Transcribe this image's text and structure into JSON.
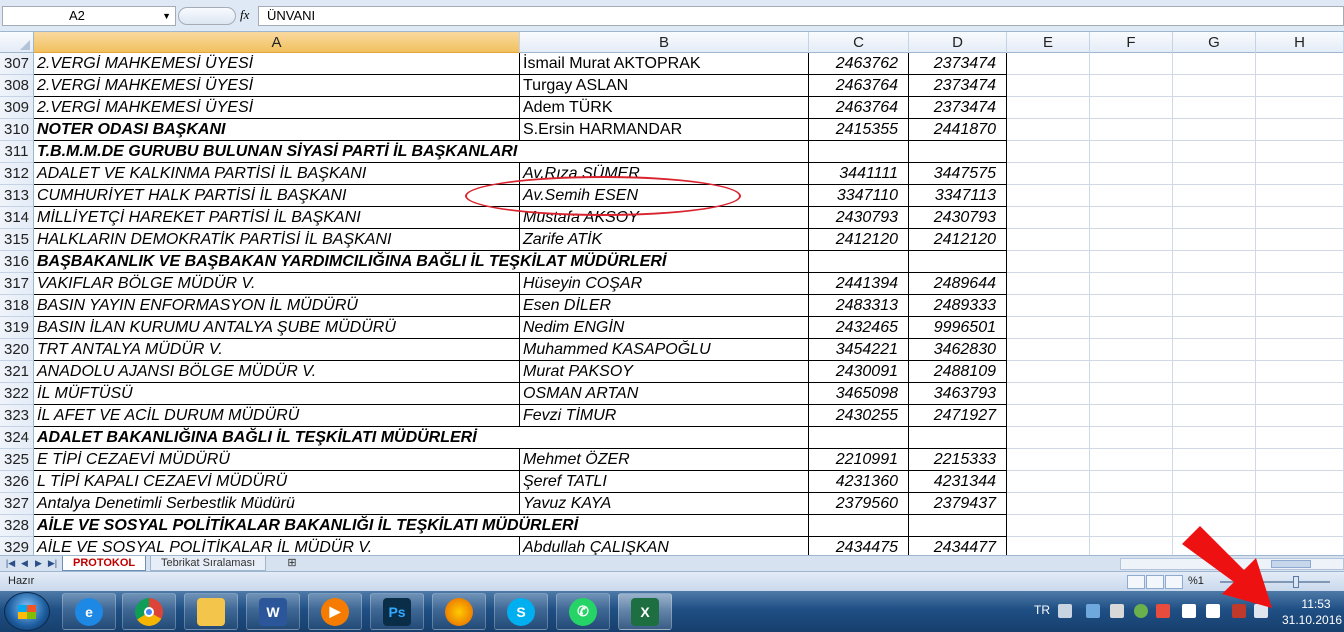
{
  "formula_bar": {
    "cell_ref": "A2",
    "fx_label": "fx",
    "content": "ÜNVANI"
  },
  "columns": [
    "A",
    "B",
    "C",
    "D",
    "E",
    "F",
    "G",
    "H"
  ],
  "rows": [
    {
      "num": "307",
      "a": "2.VERGİ MAHKEMESİ ÜYESİ",
      "b": "İsmail Murat AKTOPRAK",
      "c": "2463762",
      "d": "2373474",
      "style": "normal"
    },
    {
      "num": "308",
      "a": "2.VERGİ MAHKEMESİ ÜYESİ",
      "b": "Turgay ASLAN",
      "c": "2463764",
      "d": "2373474",
      "style": "normal"
    },
    {
      "num": "309",
      "a": "2.VERGİ MAHKEMESİ ÜYESİ",
      "b": "Adem TÜRK",
      "c": "2463764",
      "d": "2373474",
      "style": "normal"
    },
    {
      "num": "310",
      "a": "NOTER ODASI BAŞKANI",
      "b": "S.Ersin HARMANDAR",
      "c": "2415355",
      "d": "2441870",
      "style": "bold"
    },
    {
      "num": "311",
      "a": "T.B.M.M.DE GURUBU BULUNAN SİYASİ PARTİ İL BAŞKANLARI",
      "b": "",
      "c": "",
      "d": "",
      "style": "header"
    },
    {
      "num": "312",
      "a": "ADALET VE KALKINMA PARTİSİ İL BAŞKANI",
      "b": "Av.Rıza SÜMER",
      "c": "3441111",
      "d": "3447575",
      "style": "italicb"
    },
    {
      "num": "313",
      "a": "CUMHURİYET HALK PARTİSİ İL BAŞKANI",
      "b": "Av.Semih ESEN",
      "c": "3347110",
      "d": "3347113",
      "style": "italicb"
    },
    {
      "num": "314",
      "a": "MİLLİYETÇİ HAREKET PARTİSİ İL BAŞKANI",
      "b": "Mustafa AKSOY",
      "c": "2430793",
      "d": "2430793",
      "style": "italicb"
    },
    {
      "num": "315",
      "a": "HALKLARIN DEMOKRATİK PARTİSİ İL BAŞKANI",
      "b": "Zarife ATİK",
      "c": "2412120",
      "d": "2412120",
      "style": "italicb"
    },
    {
      "num": "316",
      "a": "BAŞBAKANLIK VE BAŞBAKAN YARDIMCILIĞINA BAĞLI İL TEŞKİLAT MÜDÜRLERİ",
      "b": "",
      "c": "",
      "d": "",
      "style": "header"
    },
    {
      "num": "317",
      "a": "VAKIFLAR BÖLGE MÜDÜR V.",
      "b": "Hüseyin COŞAR",
      "c": "2441394",
      "d": "2489644",
      "style": "italicb"
    },
    {
      "num": "318",
      "a": "BASIN YAYIN ENFORMASYON İL MÜDÜRÜ",
      "b": "Esen DİLER",
      "c": "2483313",
      "d": "2489333",
      "style": "italicb"
    },
    {
      "num": "319",
      "a": "BASIN İLAN KURUMU ANTALYA ŞUBE MÜDÜRÜ",
      "b": "Nedim ENGİN",
      "c": "2432465",
      "d": "9996501",
      "style": "italicb"
    },
    {
      "num": "320",
      "a": "TRT ANTALYA MÜDÜR V.",
      "b": "Muhammed KASAPOĞLU",
      "c": "3454221",
      "d": "3462830",
      "style": "italicb"
    },
    {
      "num": "321",
      "a": "ANADOLU AJANSI BÖLGE MÜDÜR V.",
      "b": "Murat PAKSOY",
      "c": "2430091",
      "d": "2488109",
      "style": "italicb"
    },
    {
      "num": "322",
      "a": "İL MÜFTÜSÜ",
      "b": "OSMAN ARTAN",
      "c": "3465098",
      "d": "3463793",
      "style": "italicb"
    },
    {
      "num": "323",
      "a": "İL AFET VE ACİL DURUM MÜDÜRÜ",
      "b": "Fevzi TİMUR",
      "c": "2430255",
      "d": "2471927",
      "style": "italicb"
    },
    {
      "num": "324",
      "a": "ADALET BAKANLIĞINA BAĞLI İL TEŞKİLATI MÜDÜRLERİ",
      "b": "",
      "c": "",
      "d": "",
      "style": "header"
    },
    {
      "num": "325",
      "a": "E TİPİ CEZAEVİ MÜDÜRÜ",
      "b": "Mehmet ÖZER",
      "c": "2210991",
      "d": "2215333",
      "style": "italicb"
    },
    {
      "num": "326",
      "a": "L TİPİ KAPALI CEZAEVİ MÜDÜRÜ",
      "b": "Şeref TATLI",
      "c": "4231360",
      "d": "4231344",
      "style": "italicb"
    },
    {
      "num": "327",
      "a": "Antalya Denetimli Serbestlik Müdürü",
      "b": "Yavuz KAYA",
      "c": "2379560",
      "d": "2379437",
      "style": "italicb"
    },
    {
      "num": "328",
      "a": "AİLE VE SOSYAL POLİTİKALAR BAKANLIĞI İL TEŞKİLATI MÜDÜRLERİ",
      "b": "",
      "c": "",
      "d": "",
      "style": "header"
    },
    {
      "num": "329",
      "a": "AİLE VE SOSYAL POLİTİKALAR İL MÜDÜR V.",
      "b": "Abdullah ÇALIŞKAN",
      "c": "2434475",
      "d": "2434477",
      "style": "italicb"
    }
  ],
  "sheet_tabs": {
    "active": "PROTOKOL",
    "other": "Tebrikat Sıralaması"
  },
  "status": {
    "text": "Hazır",
    "zoom": "%1"
  },
  "taskbar": {
    "lang": "TR",
    "time": "11:53",
    "date": "31.10.2016",
    "apps": [
      "internet-explorer",
      "chrome",
      "file-explorer",
      "word",
      "media-player",
      "photoshop",
      "firefox",
      "skype",
      "whatsapp",
      "excel"
    ]
  },
  "colors": {
    "accent_red": "#d9232e",
    "header_blue": "#dfe9f5",
    "taskbar_blue": "#1f4f84"
  }
}
